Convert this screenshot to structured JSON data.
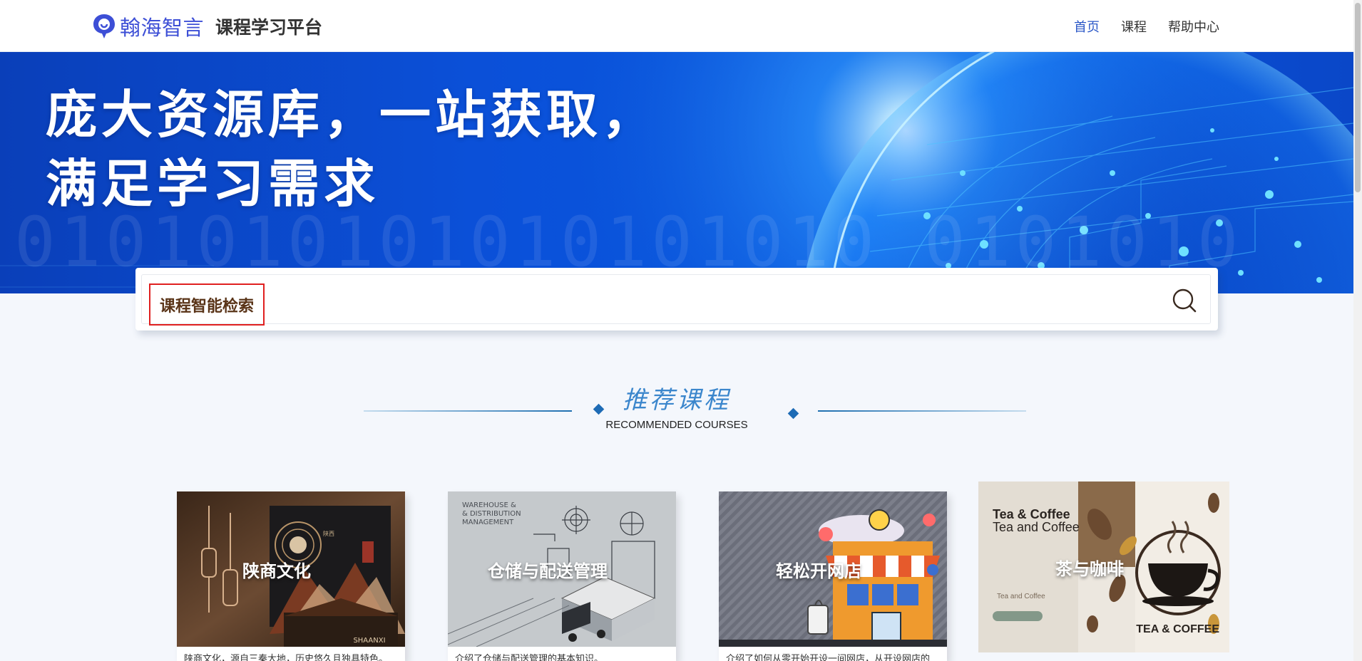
{
  "header": {
    "brand": "翰海智言",
    "platform": "课程学习平台",
    "nav": [
      {
        "label": "首页",
        "active": true
      },
      {
        "label": "课程",
        "active": false
      },
      {
        "label": "帮助中心",
        "active": false
      }
    ]
  },
  "banner": {
    "line1": "庞大资源库，一站获取，",
    "line2": "满足学习需求",
    "background_digits": "0101010101010101010 0101010"
  },
  "search": {
    "label": "课程智能检索",
    "icon": "search-icon"
  },
  "section": {
    "title_cn": "推荐课程",
    "title_en": "RECOMMENDED COURSES"
  },
  "courses": [
    {
      "title": "陕商文化",
      "desc": "陕商文化，源自三秦大地，历史悠久且独具特色。"
    },
    {
      "title": "仓储与配送管理",
      "desc": "介绍了仓储与配送管理的基本知识。"
    },
    {
      "title": "轻松开网店",
      "desc": "介绍了如何从零开始开设一间网店，从开设网店的"
    },
    {
      "title": "茶与咖啡",
      "desc": ""
    }
  ],
  "course_images": {
    "c1": {
      "seal": "陕西",
      "caption": "SHAANXI"
    },
    "c2": {
      "lines": [
        "WAREHOUSE &",
        "& DISTRIBUTION",
        "MANAGEMENT"
      ]
    },
    "c4": {
      "line1": "Tea & Coffee",
      "line2": "Tea and Coffee",
      "small": "Tea and Coffee",
      "badge": "TEA & COFFEE"
    }
  },
  "colors": {
    "accent": "#2a57c7",
    "brand": "#3d4fd6",
    "banner": "#0b50d8",
    "search_label_border": "#e02020"
  }
}
